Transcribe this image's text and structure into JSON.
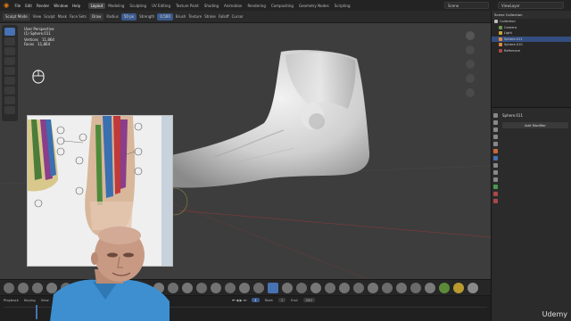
{
  "app": {
    "title_hint": "Blender",
    "menus": [
      "File",
      "Edit",
      "Render",
      "Window",
      "Help"
    ],
    "workspace_tabs": [
      "Layout",
      "Modeling",
      "Sculpting",
      "UV Editing",
      "Texture Paint",
      "Shading",
      "Animation",
      "Rendering",
      "Compositing",
      "Geometry Nodes",
      "Scripting"
    ],
    "active_tab": "Layout",
    "scene": "Scene",
    "view_layer": "ViewLayer"
  },
  "header": {
    "mode": "Sculpt Mode",
    "view": "View",
    "sculpt": "Sculpt",
    "mask": "Mask",
    "face_sets": "Face Sets",
    "brush": "Draw",
    "radius_label": "Radius",
    "radius_value": "50 px",
    "strength_label": "Strength",
    "strength_value": "0.500",
    "menus_right": [
      "Brush",
      "Texture",
      "Stroke",
      "Falloff",
      "Cursor"
    ]
  },
  "viewport": {
    "view_label": "User Perspective",
    "object_label": "(1) Sphere.011",
    "vertices_label": "Vertices",
    "vertices_value": "11,864",
    "faces_label": "Faces",
    "faces_value": "11,864"
  },
  "outliner": {
    "title": "Scene Collection",
    "items": [
      {
        "label": "Collection",
        "level": 0
      },
      {
        "label": "Camera",
        "level": 1
      },
      {
        "label": "Light",
        "level": 1
      },
      {
        "label": "Sphere.011",
        "level": 1,
        "selected": true
      },
      {
        "label": "Sphere.010",
        "level": 1
      },
      {
        "label": "Reference",
        "level": 1
      }
    ]
  },
  "properties": {
    "object_name": "Sphere.011",
    "add_modifier": "Add Modifier"
  },
  "timeline": {
    "playback": "Playback",
    "keying": "Keying",
    "view": "View",
    "marker": "Marker",
    "start_label": "Start",
    "start_value": "1",
    "end_label": "End",
    "end_value": "250",
    "current_frame": "1"
  },
  "watermark": "Udemy",
  "colors": {
    "viewport_bg": "#3d3d3d",
    "accent_blue": "#4772b3",
    "udemy": "#ffffff"
  }
}
